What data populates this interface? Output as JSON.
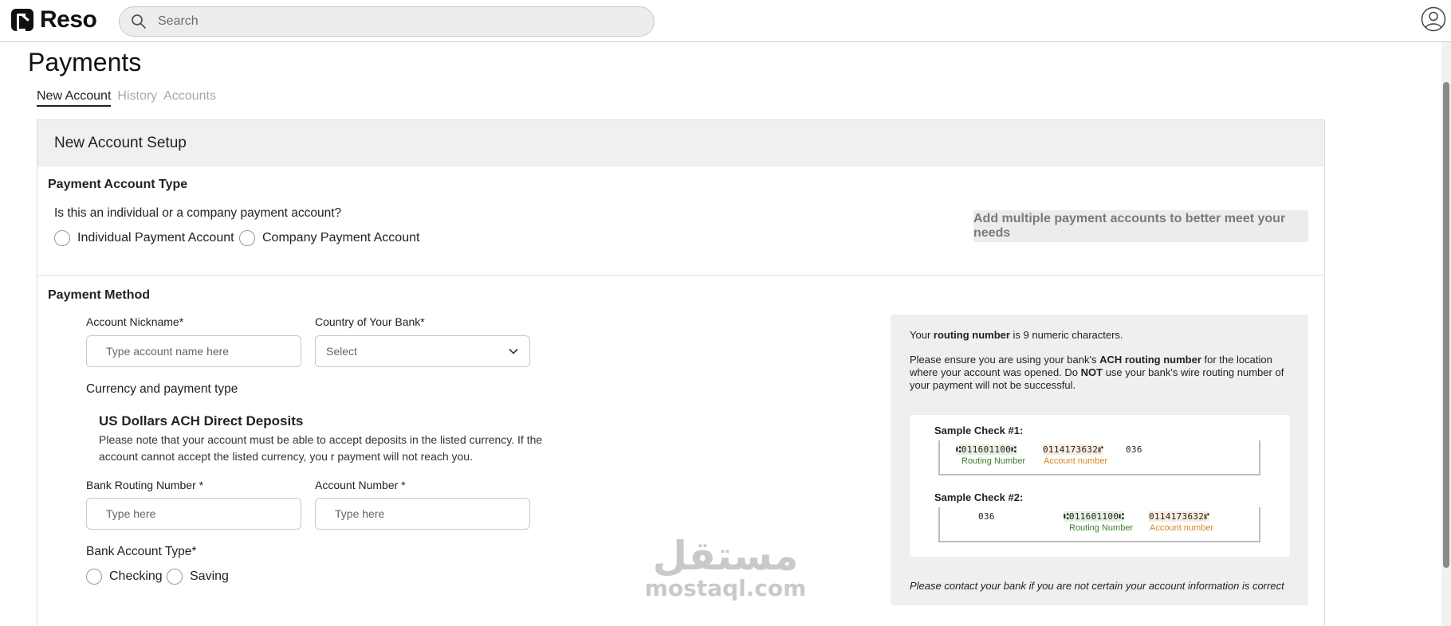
{
  "app": {
    "name": "Reso"
  },
  "search": {
    "placeholder": "Search"
  },
  "page": {
    "title": "Payments"
  },
  "tabs": [
    {
      "label": "New Account",
      "active": true
    },
    {
      "label": "History",
      "active": false
    },
    {
      "label": "Accounts",
      "active": false
    }
  ],
  "card": {
    "title": "New Account Setup",
    "account_type": {
      "title": "Payment Account Type",
      "question": "Is this an individual or a company payment account?",
      "options": [
        "Individual Payment Account",
        "Company Payment Account"
      ],
      "tip": "Add multiple payment accounts to better meet your needs"
    },
    "method": {
      "title": "Payment Method",
      "nickname_label": "Account Nickname*",
      "nickname_placeholder": "Type account name here",
      "country_label": "Country of Your Bank*",
      "country_value": "Select",
      "currency_label": "Currency and payment type",
      "ach_title": "US Dollars ACH Direct Deposits",
      "ach_note": "Please note that your account must be able to accept deposits in the listed currency. If the account cannot accept the listed currency, you r payment will not reach you.",
      "routing_label": "Bank Routing Number *",
      "routing_placeholder": "Type here",
      "account_label": "Account Number *",
      "account_placeholder": "Type here",
      "bank_type_label": "Bank Account Type*",
      "bank_type_options": [
        "Checking",
        "Saving"
      ]
    },
    "routing_info": {
      "line1_pre": "Your ",
      "line1_bold": "routing number",
      "line1_post": " is 9 numeric characters.",
      "line2_pre": "Please ensure you are using your bank's ",
      "line2_bold": "ACH routing number",
      "line2_mid": " for the location where your account was opened. Do ",
      "line2_bold2": "NOT",
      "line2_post": " use your bank's wire routing number of your payment will not be successful.",
      "check1_title": "Sample Check #1:",
      "check2_title": "Sample Check #2:",
      "routing_digits": "⑆011601100⑆",
      "account_digits": "0114173632⑈",
      "check_number": "036",
      "routing_caption": "Routing Number",
      "account_caption": "Account number",
      "footer": "Please contact your bank if you are not certain your account information is correct"
    }
  },
  "watermark": {
    "arabic": "مستقل",
    "latin": "mostaql.com"
  },
  "colors": {
    "routing_green": "#3d7d2c",
    "account_orange": "#d98423",
    "tip_text": "#7a7a7a"
  }
}
